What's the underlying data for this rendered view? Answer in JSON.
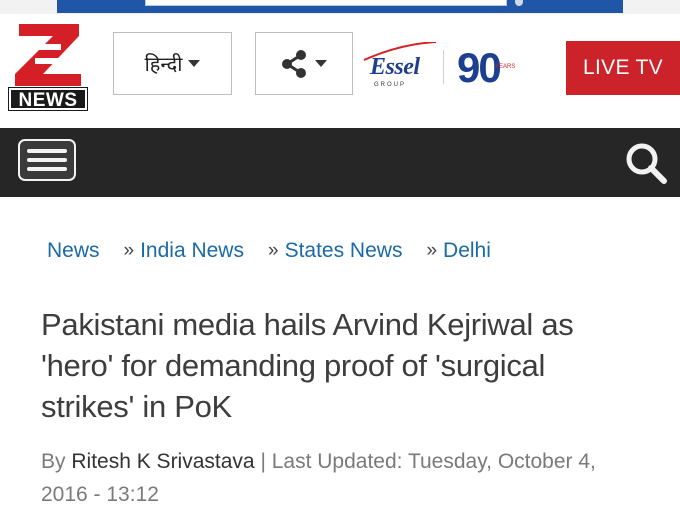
{
  "header": {
    "logo_text": "NEWS",
    "language_label": "हिन्दी",
    "partner_logo_text": "Essel",
    "partner_logo_subtext": "GROUP",
    "anniversary_number": "90",
    "anniversary_word": "YEARS",
    "live_tv_label": "LIVE TV"
  },
  "breadcrumb": {
    "items": [
      "News",
      "India News",
      "States News",
      "Delhi"
    ],
    "separator": "»"
  },
  "article": {
    "headline": "Pakistani media hails Arvind Kejriwal as 'hero' for demanding proof of 'surgical strikes' in PoK",
    "by_prefix": "By",
    "author": "Ritesh K Srivastava",
    "updated_text": "| Last Updated: Tuesday, October 4, 2016 - 13:12"
  },
  "icons": {
    "share": "share-icon",
    "menu": "hamburger-menu-icon",
    "search": "search-icon"
  },
  "colors": {
    "brand_red": "#cc2229",
    "navbar": "#262626",
    "link_blue": "#1a6aa8",
    "ad_blue": "#1f56a8"
  }
}
